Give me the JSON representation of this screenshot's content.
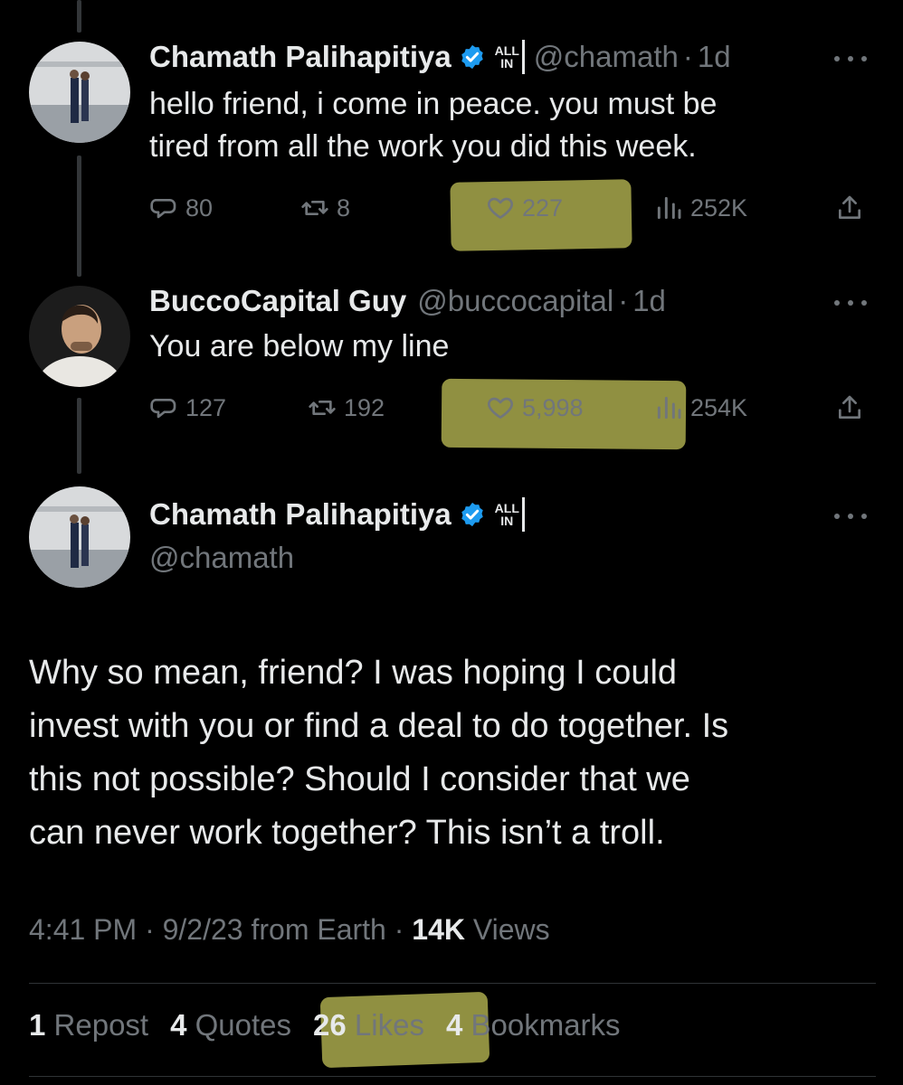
{
  "tweets": [
    {
      "display_name": "Chamath Palihapitiya",
      "badge": [
        "ALL",
        "IN"
      ],
      "handle": "@chamath",
      "separator": "·",
      "time": "1d",
      "text_lines": [
        "hello friend, i come in peace.  you must be",
        "tired from all the work you did this week."
      ],
      "replies": "80",
      "reposts": "8",
      "likes": "227",
      "views": "252K",
      "likes_highlighted": true
    },
    {
      "display_name": "BuccoCapital Guy",
      "handle": "@buccocapital",
      "separator": "·",
      "time": "1d",
      "text_lines": [
        "You are below my line"
      ],
      "replies": "127",
      "reposts": "192",
      "likes": "5,998",
      "views": "254K",
      "likes_highlighted": true
    }
  ],
  "main_tweet": {
    "display_name": "Chamath Palihapitiya",
    "badge": [
      "ALL",
      "IN"
    ],
    "handle": "@chamath",
    "text_lines": [
      "Why so mean, friend? I was hoping I could",
      "invest with you or find a deal to do together. Is",
      "this not possible? Should I consider that we",
      "can never work together? This isn’t a troll."
    ],
    "meta": {
      "time": "4:41 PM",
      "date": "9/2/23",
      "source": "from Earth",
      "separator": "·",
      "views_count": "14K",
      "views_label": "Views"
    },
    "stats": {
      "reposts_count": "1",
      "reposts_label": "Repost",
      "quotes_count": "4",
      "quotes_label": "Quotes",
      "likes_count": "26",
      "likes_label": "Likes",
      "bookmarks_count": "4",
      "bookmarks_label": "Bookmarks"
    }
  },
  "colors": {
    "background": "#000000",
    "primary_text": "#e7e9ea",
    "secondary_text": "#71767b",
    "verified_badge": "#1d9bf0",
    "highlighter": "#c8c85a"
  }
}
